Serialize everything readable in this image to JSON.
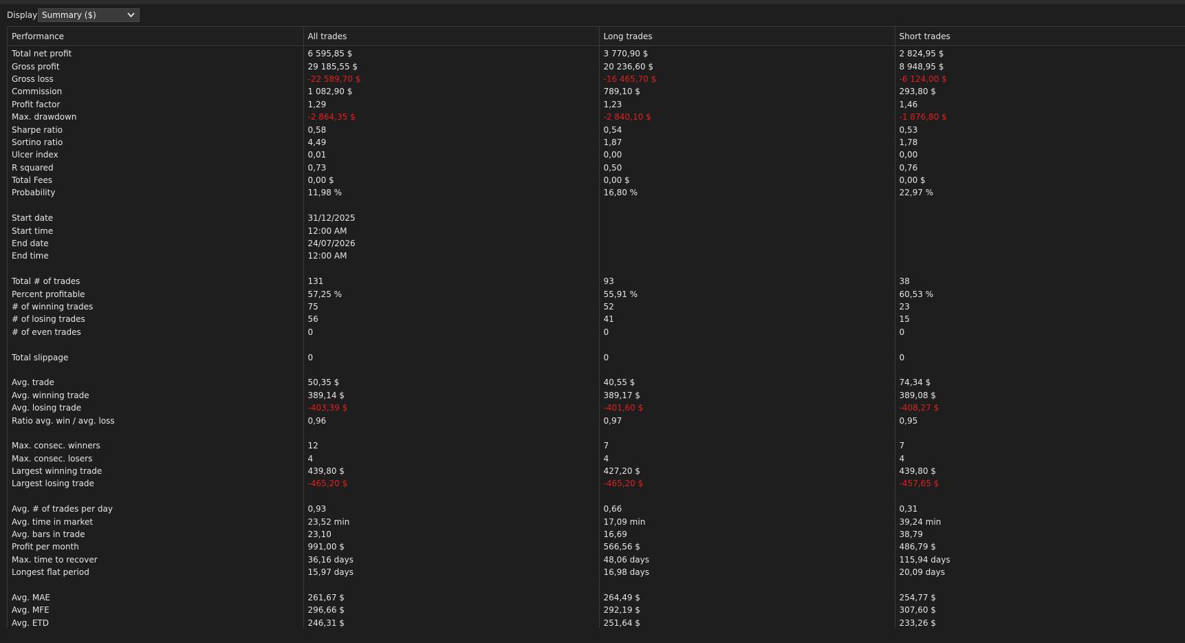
{
  "toolbar": {
    "display_label": "Display",
    "display_value": "Summary ($)",
    "dropdown_icon": "chevron-down-icon"
  },
  "colors": {
    "background": "#1e1e1e",
    "text": "#e6e6e6",
    "negative": "#e02020",
    "grid": "#3a3a3a"
  },
  "table": {
    "headers": [
      "Performance",
      "All trades",
      "Long trades",
      "Short trades"
    ],
    "rows": [
      {
        "label": "Total net profit",
        "cells": [
          {
            "v": "6 595,85 $"
          },
          {
            "v": "3 770,90 $"
          },
          {
            "v": "2 824,95 $"
          }
        ]
      },
      {
        "label": "Gross profit",
        "cells": [
          {
            "v": "29 185,55 $"
          },
          {
            "v": "20 236,60 $"
          },
          {
            "v": "8 948,95 $"
          }
        ]
      },
      {
        "label": "Gross loss",
        "cells": [
          {
            "v": "-22 589,70 $",
            "neg": true
          },
          {
            "v": "-16 465,70 $",
            "neg": true
          },
          {
            "v": "-6 124,00 $",
            "neg": true
          }
        ]
      },
      {
        "label": "Commission",
        "cells": [
          {
            "v": "1 082,90 $"
          },
          {
            "v": "789,10 $"
          },
          {
            "v": "293,80 $"
          }
        ]
      },
      {
        "label": "Profit factor",
        "cells": [
          {
            "v": "1,29"
          },
          {
            "v": "1,23"
          },
          {
            "v": "1,46"
          }
        ]
      },
      {
        "label": "Max. drawdown",
        "cells": [
          {
            "v": "-2 864,35 $",
            "neg": true
          },
          {
            "v": "-2 840,10 $",
            "neg": true
          },
          {
            "v": "-1 876,80 $",
            "neg": true
          }
        ]
      },
      {
        "label": "Sharpe ratio",
        "cells": [
          {
            "v": "0,58"
          },
          {
            "v": "0,54"
          },
          {
            "v": "0,53"
          }
        ]
      },
      {
        "label": "Sortino ratio",
        "cells": [
          {
            "v": "4,49"
          },
          {
            "v": "1,87"
          },
          {
            "v": "1,78"
          }
        ]
      },
      {
        "label": "Ulcer index",
        "cells": [
          {
            "v": "0,01"
          },
          {
            "v": "0,00"
          },
          {
            "v": "0,00"
          }
        ]
      },
      {
        "label": "R squared",
        "cells": [
          {
            "v": "0,73"
          },
          {
            "v": "0,50"
          },
          {
            "v": "0,76"
          }
        ]
      },
      {
        "label": "Total Fees",
        "cells": [
          {
            "v": "0,00 $"
          },
          {
            "v": "0,00 $"
          },
          {
            "v": "0,00 $"
          }
        ]
      },
      {
        "label": "Probability",
        "cells": [
          {
            "v": "11,98 %"
          },
          {
            "v": "16,80 %"
          },
          {
            "v": "22,97 %"
          }
        ]
      },
      {
        "label": "",
        "cells": [
          {
            "v": ""
          },
          {
            "v": ""
          },
          {
            "v": ""
          }
        ]
      },
      {
        "label": "Start date",
        "cells": [
          {
            "v": "31/12/2025"
          },
          {
            "v": ""
          },
          {
            "v": ""
          }
        ]
      },
      {
        "label": "Start time",
        "cells": [
          {
            "v": "12:00 AM"
          },
          {
            "v": ""
          },
          {
            "v": ""
          }
        ]
      },
      {
        "label": "End date",
        "cells": [
          {
            "v": "24/07/2026"
          },
          {
            "v": ""
          },
          {
            "v": ""
          }
        ]
      },
      {
        "label": "End time",
        "cells": [
          {
            "v": "12:00 AM"
          },
          {
            "v": ""
          },
          {
            "v": ""
          }
        ]
      },
      {
        "label": "",
        "cells": [
          {
            "v": ""
          },
          {
            "v": ""
          },
          {
            "v": ""
          }
        ]
      },
      {
        "label": "Total # of trades",
        "cells": [
          {
            "v": "131"
          },
          {
            "v": "93"
          },
          {
            "v": "38"
          }
        ]
      },
      {
        "label": "Percent profitable",
        "cells": [
          {
            "v": "57,25 %"
          },
          {
            "v": "55,91 %"
          },
          {
            "v": "60,53 %"
          }
        ]
      },
      {
        "label": "# of winning trades",
        "cells": [
          {
            "v": "75"
          },
          {
            "v": "52"
          },
          {
            "v": "23"
          }
        ]
      },
      {
        "label": "# of losing trades",
        "cells": [
          {
            "v": "56"
          },
          {
            "v": "41"
          },
          {
            "v": "15"
          }
        ]
      },
      {
        "label": "# of even trades",
        "cells": [
          {
            "v": "0"
          },
          {
            "v": "0"
          },
          {
            "v": "0"
          }
        ]
      },
      {
        "label": "",
        "cells": [
          {
            "v": ""
          },
          {
            "v": ""
          },
          {
            "v": ""
          }
        ]
      },
      {
        "label": "Total slippage",
        "cells": [
          {
            "v": "0"
          },
          {
            "v": "0"
          },
          {
            "v": "0"
          }
        ]
      },
      {
        "label": "",
        "cells": [
          {
            "v": ""
          },
          {
            "v": ""
          },
          {
            "v": ""
          }
        ]
      },
      {
        "label": "Avg. trade",
        "cells": [
          {
            "v": "50,35 $"
          },
          {
            "v": "40,55 $"
          },
          {
            "v": "74,34 $"
          }
        ]
      },
      {
        "label": "Avg. winning trade",
        "cells": [
          {
            "v": "389,14 $"
          },
          {
            "v": "389,17 $"
          },
          {
            "v": "389,08 $"
          }
        ]
      },
      {
        "label": "Avg. losing trade",
        "cells": [
          {
            "v": "-403,39 $",
            "neg": true
          },
          {
            "v": "-401,60 $",
            "neg": true
          },
          {
            "v": "-408,27 $",
            "neg": true
          }
        ]
      },
      {
        "label": "Ratio avg. win / avg. loss",
        "cells": [
          {
            "v": "0,96"
          },
          {
            "v": "0,97"
          },
          {
            "v": "0,95"
          }
        ]
      },
      {
        "label": "",
        "cells": [
          {
            "v": ""
          },
          {
            "v": ""
          },
          {
            "v": ""
          }
        ]
      },
      {
        "label": "Max. consec. winners",
        "cells": [
          {
            "v": "12"
          },
          {
            "v": "7"
          },
          {
            "v": "7"
          }
        ]
      },
      {
        "label": "Max. consec. losers",
        "cells": [
          {
            "v": "4"
          },
          {
            "v": "4"
          },
          {
            "v": "4"
          }
        ]
      },
      {
        "label": "Largest winning trade",
        "cells": [
          {
            "v": "439,80 $"
          },
          {
            "v": "427,20 $"
          },
          {
            "v": "439,80 $"
          }
        ]
      },
      {
        "label": "Largest losing trade",
        "cells": [
          {
            "v": "-465,20 $",
            "neg": true
          },
          {
            "v": "-465,20 $",
            "neg": true
          },
          {
            "v": "-457,65 $",
            "neg": true
          }
        ]
      },
      {
        "label": "",
        "cells": [
          {
            "v": ""
          },
          {
            "v": ""
          },
          {
            "v": ""
          }
        ]
      },
      {
        "label": "Avg. # of trades per day",
        "cells": [
          {
            "v": "0,93"
          },
          {
            "v": "0,66"
          },
          {
            "v": "0,31"
          }
        ]
      },
      {
        "label": "Avg. time in market",
        "cells": [
          {
            "v": "23,52 min"
          },
          {
            "v": "17,09 min"
          },
          {
            "v": "39,24 min"
          }
        ]
      },
      {
        "label": "Avg. bars in trade",
        "cells": [
          {
            "v": "23,10"
          },
          {
            "v": "16,69"
          },
          {
            "v": "38,79"
          }
        ]
      },
      {
        "label": "Profit per month",
        "cells": [
          {
            "v": "991,00 $"
          },
          {
            "v": "566,56 $"
          },
          {
            "v": "486,79 $"
          }
        ]
      },
      {
        "label": "Max. time to recover",
        "cells": [
          {
            "v": "36,16 days"
          },
          {
            "v": "48,06 days"
          },
          {
            "v": "115,94 days"
          }
        ]
      },
      {
        "label": "Longest flat period",
        "cells": [
          {
            "v": "15,97 days"
          },
          {
            "v": "16,98 days"
          },
          {
            "v": "20,09 days"
          }
        ]
      },
      {
        "label": "",
        "cells": [
          {
            "v": ""
          },
          {
            "v": ""
          },
          {
            "v": ""
          }
        ]
      },
      {
        "label": "Avg. MAE",
        "cells": [
          {
            "v": "261,67 $"
          },
          {
            "v": "264,49 $"
          },
          {
            "v": "254,77 $"
          }
        ]
      },
      {
        "label": "Avg. MFE",
        "cells": [
          {
            "v": "296,66 $"
          },
          {
            "v": "292,19 $"
          },
          {
            "v": "307,60 $"
          }
        ]
      },
      {
        "label": "Avg. ETD",
        "cells": [
          {
            "v": "246,31 $"
          },
          {
            "v": "251,64 $"
          },
          {
            "v": "233,26 $"
          }
        ]
      }
    ]
  }
}
